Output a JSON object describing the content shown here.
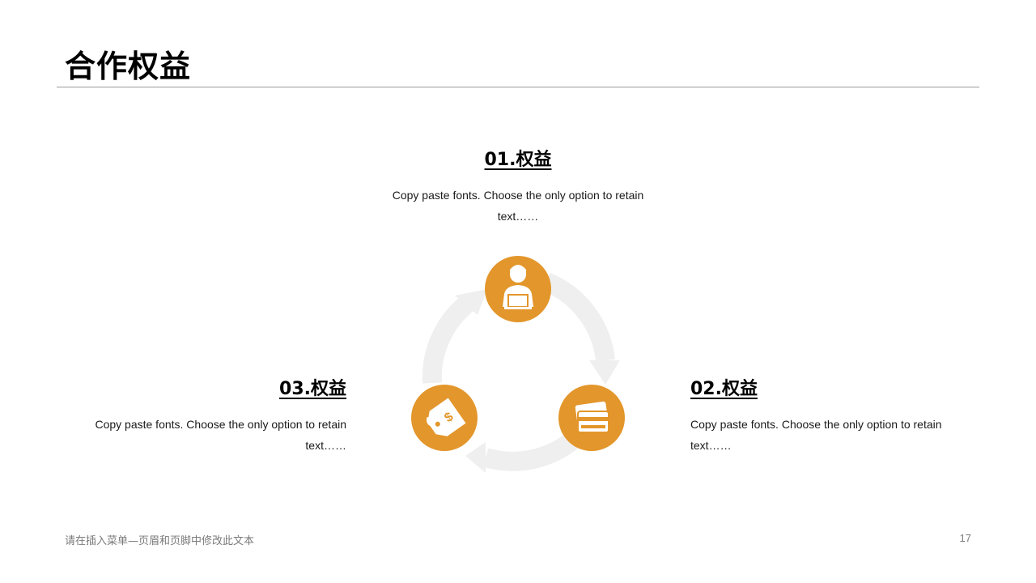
{
  "slide": {
    "title": "合作权益",
    "accent_color": "#e3962b",
    "arrow_color": "#efefef"
  },
  "benefits": [
    {
      "heading": "01.权益",
      "text": "Copy paste fonts. Choose the only option to retain text……",
      "icon": "person-laptop-icon"
    },
    {
      "heading": "02.权益",
      "text": "Copy paste fonts. Choose the only option to retain text……",
      "icon": "credit-card-icon"
    },
    {
      "heading": "03.权益",
      "text": "Copy paste fonts. Choose the only option to retain text……",
      "icon": "price-tag-icon"
    }
  ],
  "footer": {
    "text": "请在插入菜单—页眉和页脚中修改此文本",
    "page_number": "17"
  }
}
